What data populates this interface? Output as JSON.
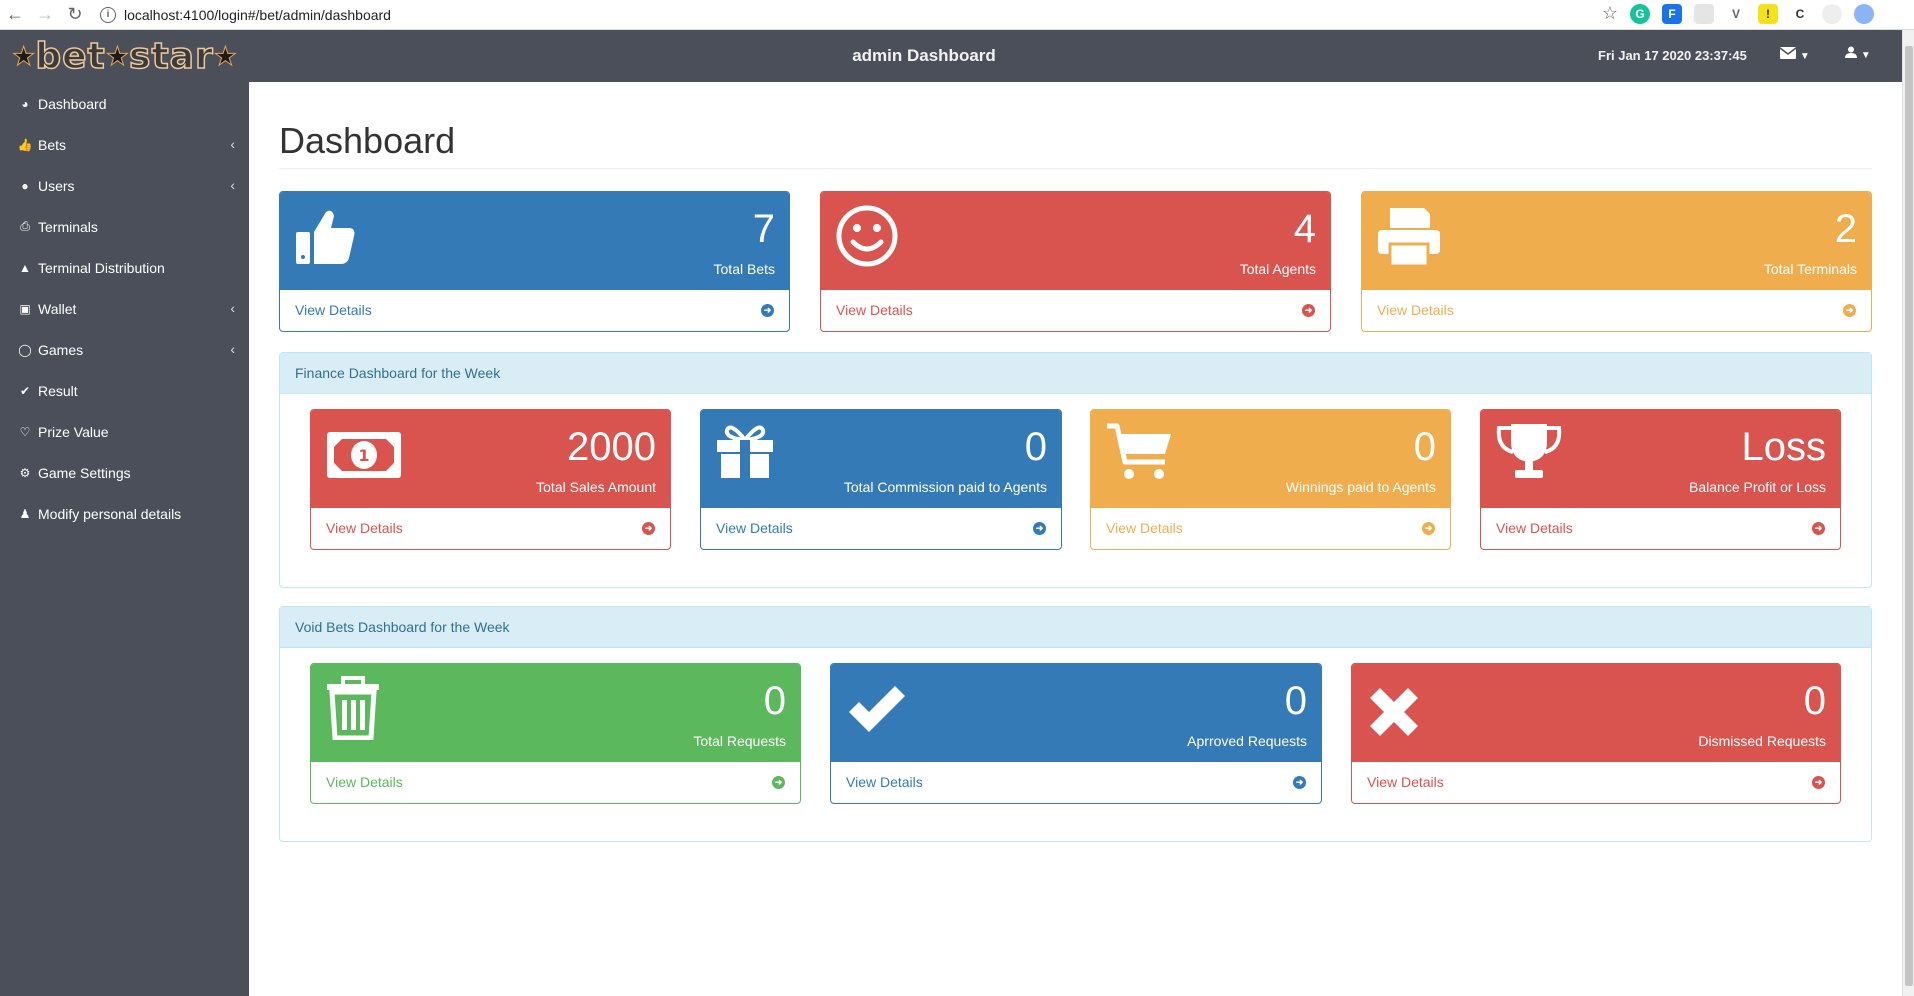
{
  "browser": {
    "url": "localhost:4100/login#/bet/admin/dashboard"
  },
  "header": {
    "logo_text": "bet",
    "logo_text2": "star",
    "title": "admin Dashboard",
    "datetime": "Fri Jan 17 2020 23:37:45"
  },
  "sidebar": {
    "items": [
      {
        "label": "Dashboard",
        "icon": "dashboard-icon"
      },
      {
        "label": "Bets",
        "icon": "thumbs-up-icon"
      },
      {
        "label": "Users",
        "icon": "users-icon"
      },
      {
        "label": "Terminals",
        "icon": "printer-icon"
      },
      {
        "label": "Terminal Distribution",
        "icon": "sitemap-icon"
      },
      {
        "label": "Wallet",
        "icon": "money-icon"
      },
      {
        "label": "Games",
        "icon": "gamepad-icon"
      },
      {
        "label": "Result",
        "icon": "check-circle-icon"
      },
      {
        "label": "Prize Value",
        "icon": "heart-icon"
      },
      {
        "label": "Game Settings",
        "icon": "cogs-icon"
      },
      {
        "label": "Modify personal details",
        "icon": "user-icon"
      }
    ]
  },
  "main": {
    "title": "Dashboard",
    "view_details": "View Details",
    "summary": [
      {
        "value": "7",
        "label": "Total Bets",
        "color": "#337ab7",
        "icon": "thumbs-up-icon"
      },
      {
        "value": "4",
        "label": "Total Agents",
        "color": "#d9534f",
        "icon": "smile-icon"
      },
      {
        "value": "2",
        "label": "Total Terminals",
        "color": "#f0ad4e",
        "icon": "printer-icon"
      }
    ],
    "finance": {
      "heading": "Finance Dashboard for the Week",
      "cards": [
        {
          "value": "2000",
          "label": "Total Sales Amount",
          "color": "#d9534f",
          "icon": "money-icon"
        },
        {
          "value": "0",
          "label": "Total Commission paid to Agents",
          "color": "#337ab7",
          "icon": "gift-icon"
        },
        {
          "value": "0",
          "label": "Winnings paid to Agents",
          "color": "#f0ad4e",
          "icon": "cart-icon"
        },
        {
          "value": "Loss",
          "label": "Balance Profit or Loss",
          "color": "#d9534f",
          "icon": "trophy-icon"
        }
      ]
    },
    "void": {
      "heading": "Void Bets Dashboard for the Week",
      "cards": [
        {
          "value": "0",
          "label": "Total Requests",
          "color": "#5cb85c",
          "icon": "trash-icon"
        },
        {
          "value": "0",
          "label": "Aprroved Requests",
          "color": "#337ab7",
          "icon": "check-icon"
        },
        {
          "value": "0",
          "label": "Dismissed Requests",
          "color": "#d9534f",
          "icon": "times-icon"
        }
      ]
    }
  }
}
